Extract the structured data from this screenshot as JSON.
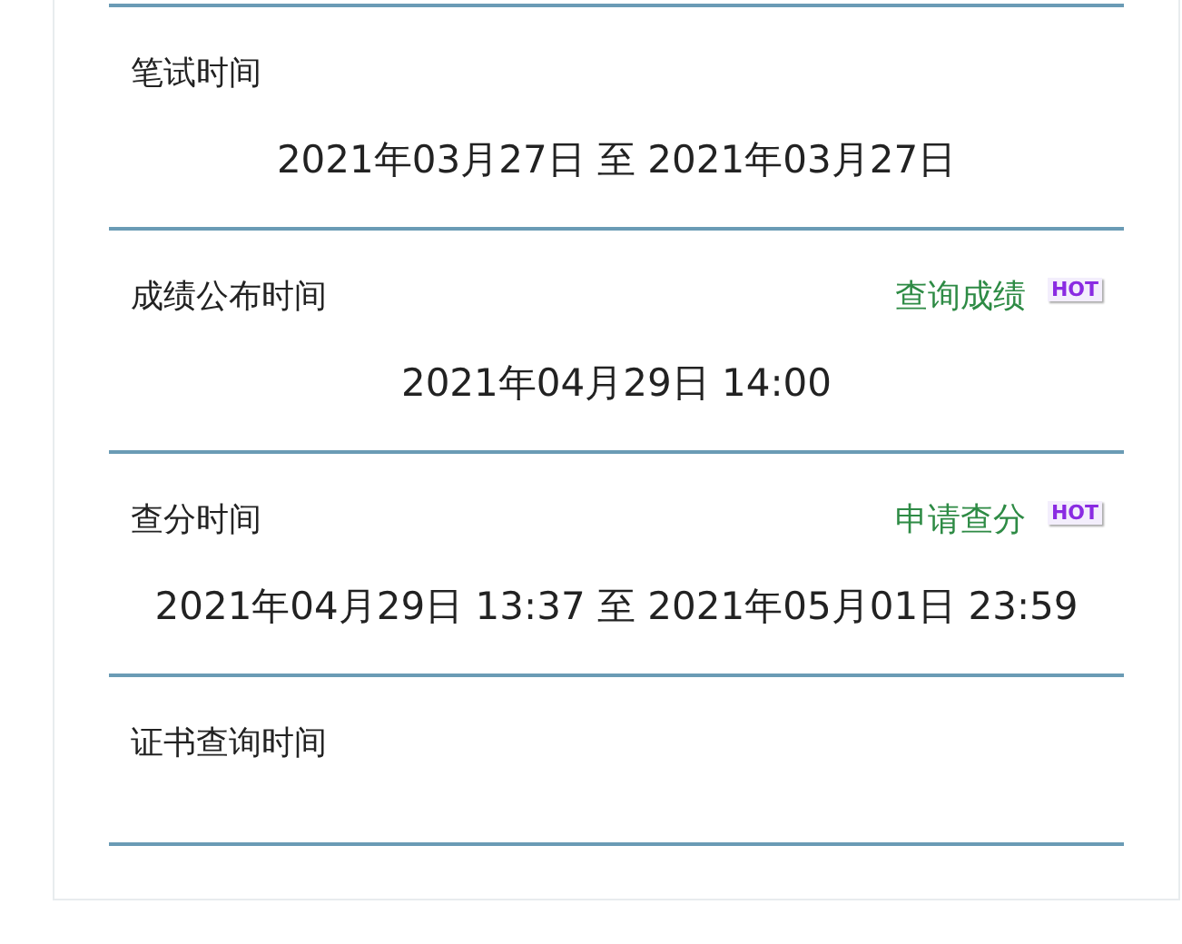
{
  "sections": [
    {
      "title": "笔试时间",
      "value": "2021年03月27日 至 2021年03月27日"
    },
    {
      "title": "成绩公布时间",
      "link": "查询成绩",
      "badge": "HOT",
      "value": "2021年04月29日 14:00"
    },
    {
      "title": "查分时间",
      "link": "申请查分",
      "badge": "HOT",
      "value": "2021年04月29日 13:37 至 2021年05月01日 23:59"
    },
    {
      "title": "证书查询时间"
    }
  ]
}
